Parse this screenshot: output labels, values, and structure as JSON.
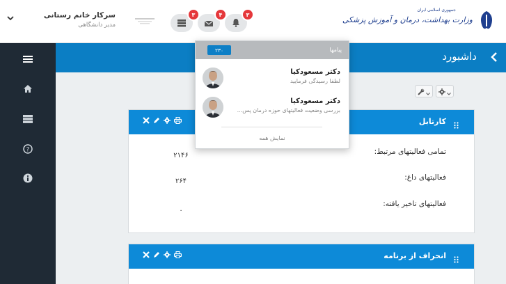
{
  "header": {
    "user_name": "سرکار خانم رستانی",
    "user_role": "مدیر دانشگاهی",
    "small_logo_text": "",
    "ministry_name": "وزارت بهداشت، درمان و آموزش پزشکی",
    "ministry_sub": "جمهوری اسلامی ایران",
    "notifications": [
      {
        "icon": "server-icon",
        "badge": "۳"
      },
      {
        "icon": "envelope-icon",
        "badge": "۴"
      },
      {
        "icon": "bell-icon",
        "badge": "۳"
      }
    ]
  },
  "sidebar": {
    "items": [
      {
        "icon": "menu-icon"
      },
      {
        "icon": "home-icon"
      },
      {
        "icon": "server-icon"
      },
      {
        "icon": "help-icon"
      },
      {
        "icon": "info-icon"
      }
    ]
  },
  "page": {
    "title": "داشبورد"
  },
  "messages_dropdown": {
    "title": "پیامها",
    "count": "۲۳۰",
    "items": [
      {
        "sender": "دکتر مسعودکیا",
        "text": "لطفا رسیدگی فرمایید"
      },
      {
        "sender": "دکتر مسعودکیا",
        "text": "بررسی وضعیت فعالیتهای حوزه درمان پس..."
      }
    ],
    "show_all": "نمایش همه"
  },
  "panels": {
    "kartabl": {
      "title": "کارتابل",
      "rows": [
        {
          "label": "تمامی فعالیتهای مرتبط:",
          "value": "۲۱۴۶"
        },
        {
          "label": "فعالیتهای داغ:",
          "value": "۲۶۴"
        },
        {
          "label": "فعالیتهای تاخیر یافته:",
          "value": "۰"
        }
      ]
    },
    "deviation": {
      "title": "انحراف از برنامه"
    }
  },
  "colors": {
    "accent": "#0b7ec4",
    "panel_header": "#0d8ad8",
    "sidebar": "#1f2a35",
    "badge": "#e5383b"
  }
}
